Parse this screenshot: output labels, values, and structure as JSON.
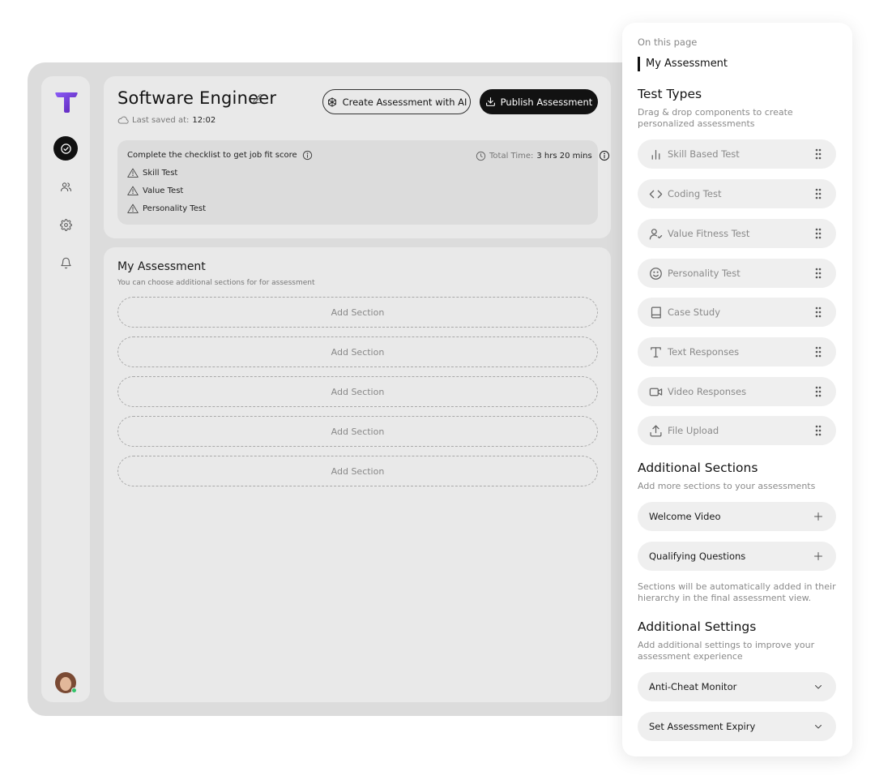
{
  "header": {
    "title": "Software Engineer",
    "last_saved_label": "Last saved at:",
    "last_saved_time": "12:02",
    "create_ai_label": "Create Assessment with AI",
    "publish_label": "Publish Assessment"
  },
  "checklist": {
    "heading": "Complete the checklist to get job fit score",
    "total_time_label": "Total Time:",
    "total_time_value": "3 hrs 20 mins",
    "items": [
      "Skill Test",
      "Value Test",
      "Personality Test"
    ]
  },
  "assessment": {
    "title": "My Assessment",
    "subtitle": "You can choose additional sections for for assessment",
    "add_section_label": "Add Section",
    "slots": 5
  },
  "sidebar": {
    "icons": [
      "check-circle-icon",
      "users-icon",
      "settings-gear-icon",
      "bell-icon"
    ],
    "active_index": 0
  },
  "panel": {
    "on_this_page": "On this page",
    "current_anchor": "My Assessment",
    "test_types": {
      "title": "Test Types",
      "description": "Drag & drop components to create personalized assessments",
      "items": [
        {
          "label": "Skill Based Test",
          "icon": "bar-chart-icon"
        },
        {
          "label": "Coding Test",
          "icon": "code-icon"
        },
        {
          "label": "Value Fitness Test",
          "icon": "user-check-icon"
        },
        {
          "label": "Personality Test",
          "icon": "smile-icon"
        },
        {
          "label": "Case Study",
          "icon": "book-icon"
        },
        {
          "label": "Text Responses",
          "icon": "text-icon"
        },
        {
          "label": "Video Responses",
          "icon": "video-icon"
        },
        {
          "label": "File Upload",
          "icon": "upload-icon"
        }
      ]
    },
    "additional_sections": {
      "title": "Additional Sections",
      "description": "Add more sections to your assessments",
      "items": [
        "Welcome Video",
        "Qualifying Questions"
      ],
      "note": "Sections will be automatically added in their hierarchy in the final assessment view."
    },
    "additional_settings": {
      "title": "Additional Settings",
      "description": "Add additional settings to improve your assessment experience",
      "items": [
        "Anti-Cheat Monitor",
        "Set Assessment Expiry"
      ]
    }
  },
  "colors": {
    "frame_bg": "#dcdcdc",
    "card_bg": "#e9e9e9",
    "dark": "#121212",
    "brand_purple": "#7c3aed",
    "row_bg": "#efefef",
    "online_green": "#32c46a"
  }
}
